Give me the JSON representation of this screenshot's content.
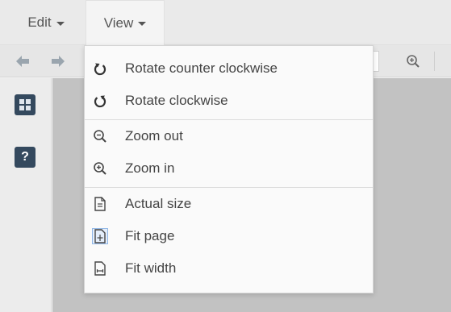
{
  "menubar": {
    "edit_label": "Edit",
    "view_label": "View"
  },
  "toolbar": {
    "icons": [
      "arrow-left-icon",
      "arrow-right-icon",
      "zoom-in-icon"
    ]
  },
  "sidebar": {
    "help_label": "?"
  },
  "view_menu": {
    "items": [
      {
        "label": "Rotate counter clockwise",
        "icon": "rotate-ccw-icon"
      },
      {
        "label": "Rotate clockwise",
        "icon": "rotate-cw-icon"
      },
      {
        "label": "Zoom out",
        "icon": "zoom-out-icon"
      },
      {
        "label": "Zoom in",
        "icon": "zoom-in-icon"
      },
      {
        "label": "Actual size",
        "icon": "actual-size-icon"
      },
      {
        "label": "Fit page",
        "icon": "fit-page-icon",
        "selected": true
      },
      {
        "label": "Fit width",
        "icon": "fit-width-icon"
      }
    ]
  },
  "colors": {
    "accent_dark": "#34495e",
    "arrow_gray": "#9aa5ae",
    "selected_border": "#8fb6e6"
  }
}
